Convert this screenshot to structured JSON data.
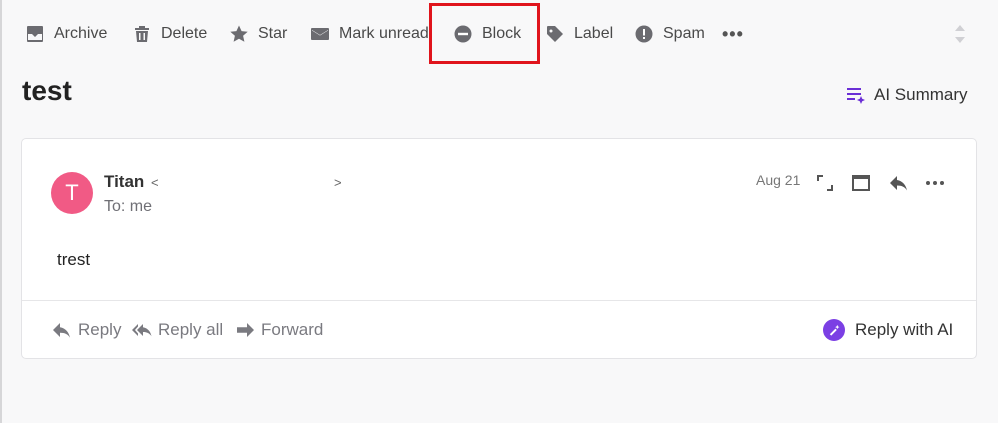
{
  "toolbar": {
    "archive": "Archive",
    "delete": "Delete",
    "star": "Star",
    "mark_unread": "Mark unread",
    "block": "Block",
    "label": "Label",
    "spam": "Spam",
    "more": "•••"
  },
  "email": {
    "subject": "test",
    "ai_summary": "AI Summary",
    "sender_name": "Titan",
    "sender_open": "<",
    "sender_close": ">",
    "to_line": "To: me",
    "date": "Aug 21",
    "body": "trest"
  },
  "footer": {
    "reply": "Reply",
    "reply_all": "Reply all",
    "forward": "Forward",
    "reply_with_ai": "Reply with AI"
  },
  "avatar": {
    "initial": "T",
    "color": "#f15a85"
  },
  "colors": {
    "accent": "#7b3fe4",
    "highlight": "#e0141c"
  },
  "icons": [
    "archive-icon",
    "trash-icon",
    "star-icon",
    "envelope-icon",
    "block-icon",
    "tag-icon",
    "spam-icon",
    "more-icon",
    "sort-icon",
    "ai-summary-icon",
    "expand-icon",
    "popout-icon",
    "reply-icon",
    "ai-icon"
  ]
}
